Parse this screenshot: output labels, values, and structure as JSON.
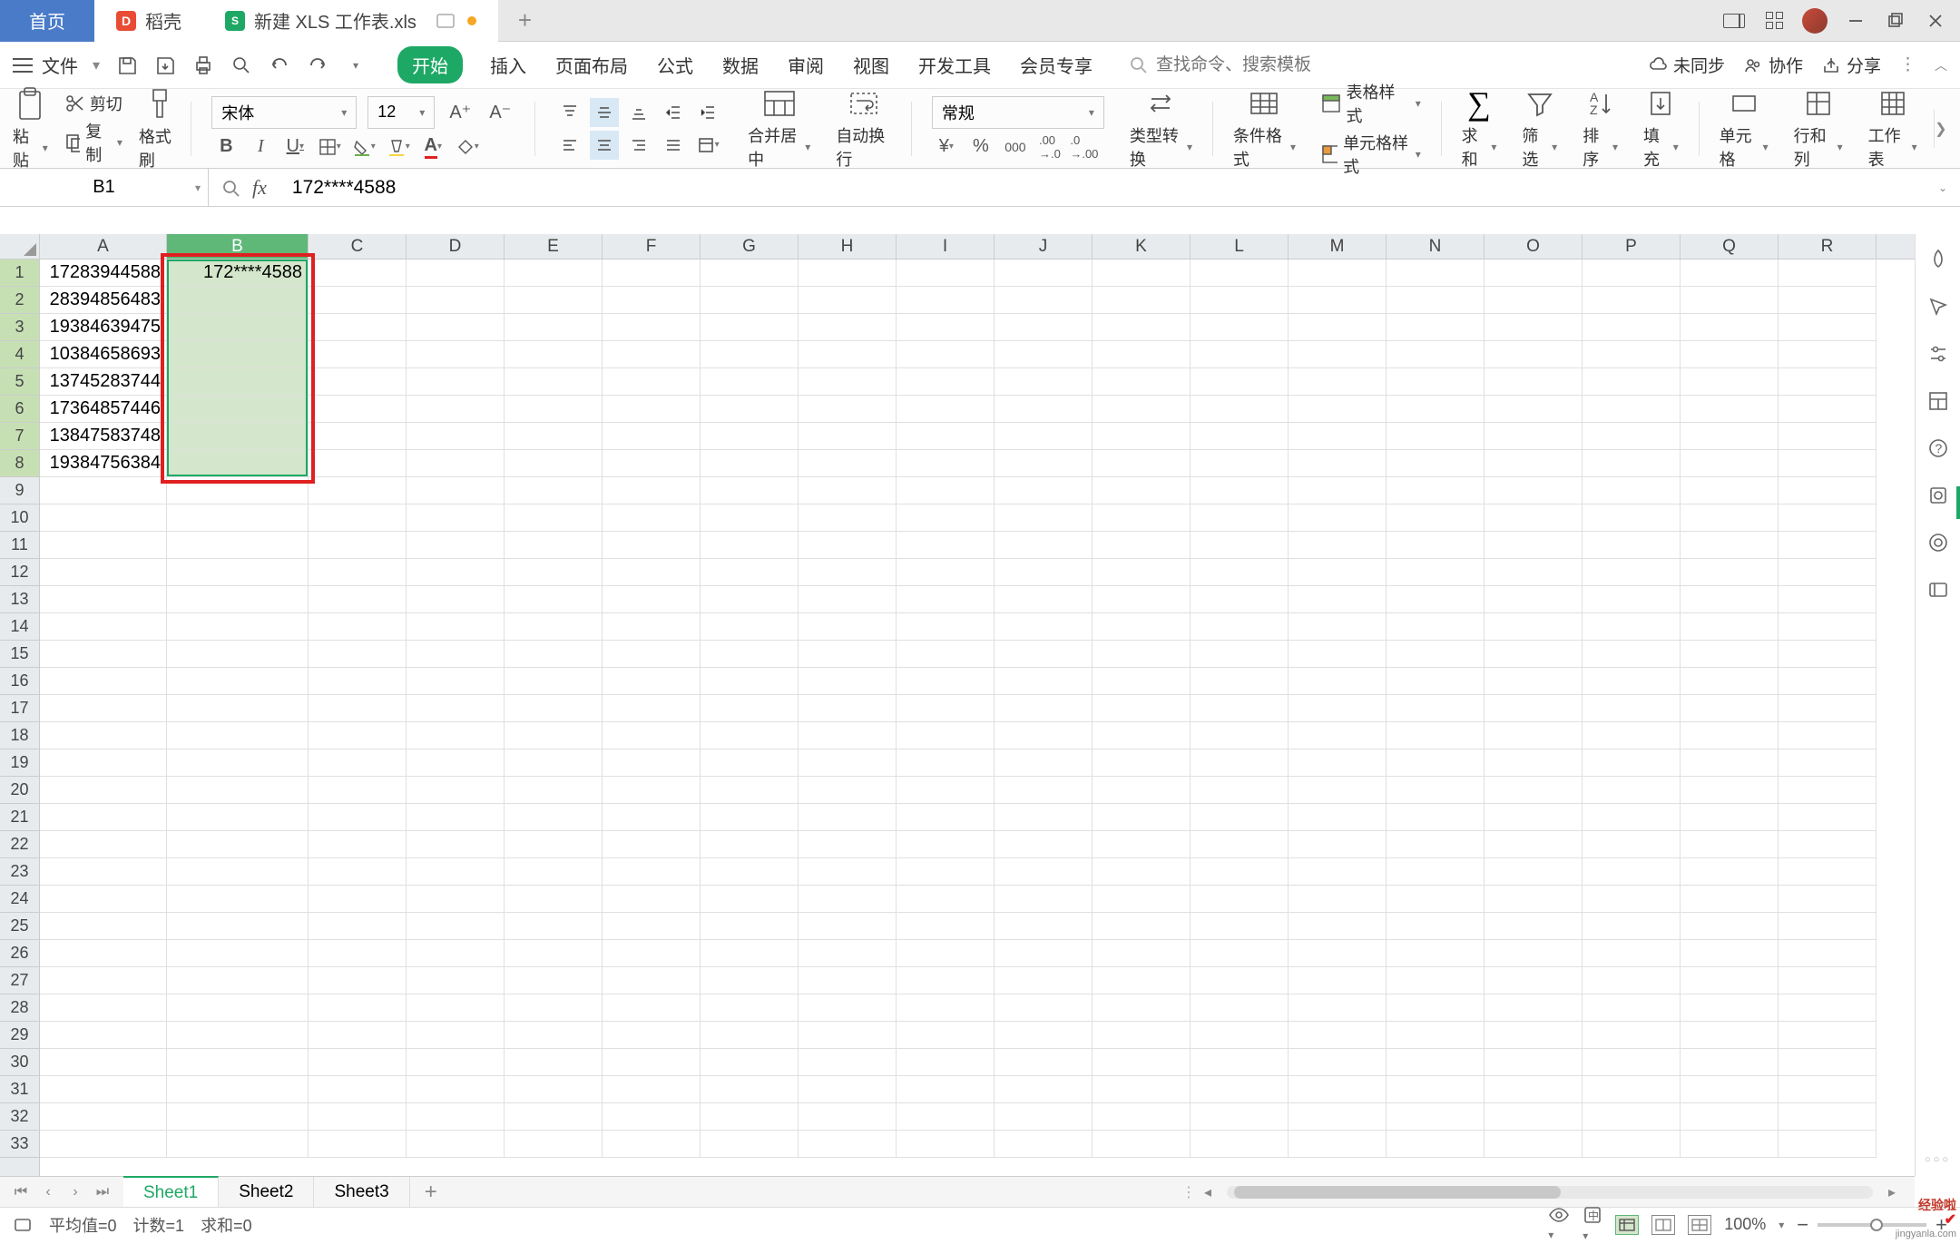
{
  "tabs": {
    "home": "首页",
    "docer": "稻壳",
    "file": "新建 XLS 工作表.xls"
  },
  "menu": {
    "file": "文件",
    "items": [
      "开始",
      "插入",
      "页面布局",
      "公式",
      "数据",
      "审阅",
      "视图",
      "开发工具",
      "会员专享"
    ],
    "search_placeholder": "查找命令、搜索模板",
    "unsync": "未同步",
    "collab": "协作",
    "share": "分享"
  },
  "ribbon": {
    "paste": "粘贴",
    "cut": "剪切",
    "copy": "复制",
    "format_painter": "格式刷",
    "font_name": "宋体",
    "font_size": "12",
    "merge_center": "合并居中",
    "auto_wrap": "自动换行",
    "number_format": "常规",
    "type_convert": "类型转换",
    "cond_format": "条件格式",
    "table_style": "表格样式",
    "cell_style": "单元格样式",
    "sum": "求和",
    "filter": "筛选",
    "sort": "排序",
    "fill": "填充",
    "cell": "单元格",
    "row_col": "行和列",
    "worksheet": "工作表"
  },
  "namebox": "B1",
  "formula_value": "172****4588",
  "columns": [
    "A",
    "B",
    "C",
    "D",
    "E",
    "F",
    "G",
    "H",
    "I",
    "J",
    "K",
    "L",
    "M",
    "N",
    "O",
    "P",
    "Q",
    "R"
  ],
  "rows": [
    "1",
    "2",
    "3",
    "4",
    "5",
    "6",
    "7",
    "8",
    "9",
    "10",
    "11",
    "12",
    "13",
    "14",
    "15",
    "16",
    "17",
    "18",
    "19",
    "20",
    "21",
    "22",
    "23",
    "24",
    "25",
    "26",
    "27",
    "28",
    "29",
    "30",
    "31",
    "32",
    "33"
  ],
  "data": {
    "A": [
      "17283944588",
      "28394856483",
      "19384639475",
      "10384658693",
      "13745283744",
      "17364857446",
      "13847583748",
      "19384756384"
    ],
    "B": [
      "172****4588"
    ]
  },
  "sheets": [
    "Sheet1",
    "Sheet2",
    "Sheet3"
  ],
  "status": {
    "avg": "平均值=0",
    "count": "计数=1",
    "sum": "求和=0",
    "zoom": "100%"
  },
  "watermark": {
    "main": "经验啦",
    "sub": "jingyanla.com"
  }
}
